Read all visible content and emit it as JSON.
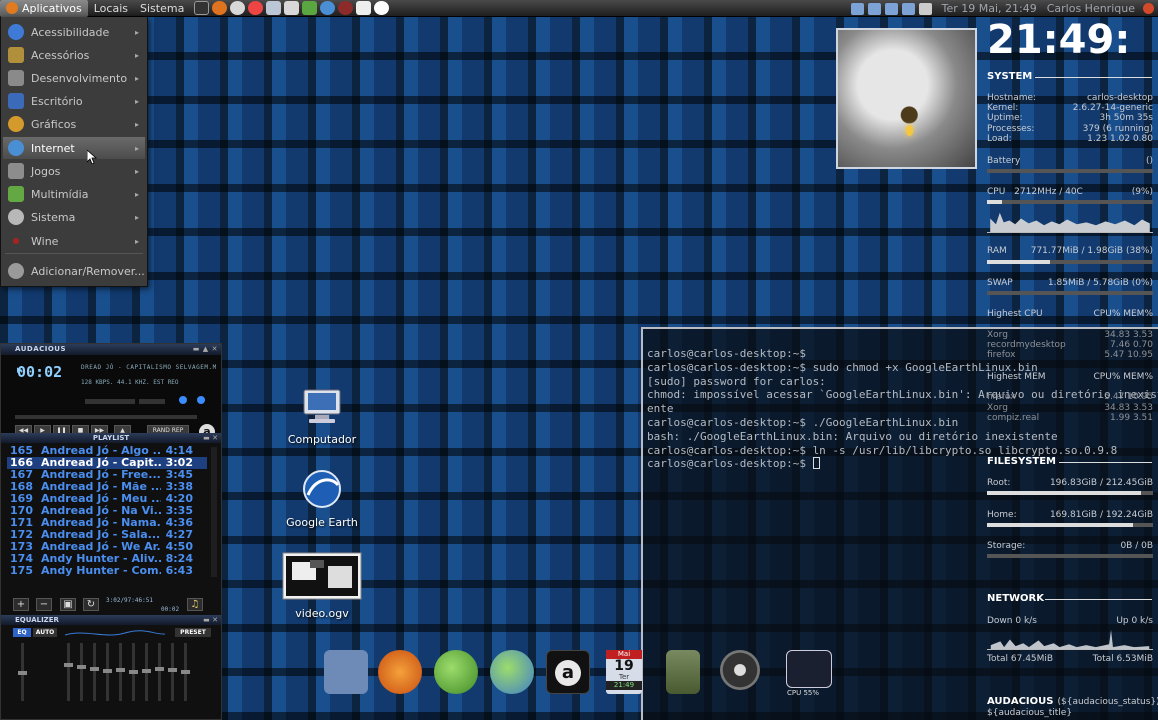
{
  "top_panel": {
    "menus": [
      "Aplicativos",
      "Locais",
      "Sistema"
    ],
    "launcher_icons": [
      "terminal-icon",
      "firefox-icon",
      "chat-icon",
      "help-icon",
      "mail-icon",
      "file-manager-icon",
      "users-icon",
      "network-icon",
      "media-icon",
      "notes-icon",
      "audacious-icon"
    ],
    "tray_icons": [
      "user-icon",
      "user-alt-icon",
      "network-icon",
      "mail-icon",
      "volume-icon"
    ],
    "clock": "Ter 19 Mai, 21:49",
    "user": "Carlos Henrique",
    "colors": {
      "panel": "#2a2a2a",
      "active_menu": "#7a7a7a"
    }
  },
  "app_menu": {
    "items": [
      {
        "label": "Acessibilidade",
        "icon": "accessibility-icon",
        "color": "#3f7bd6"
      },
      {
        "label": "Acessórios",
        "icon": "accessories-icon",
        "color": "#b0903a"
      },
      {
        "label": "Desenvolvimento",
        "icon": "development-icon",
        "color": "#8a8a8a"
      },
      {
        "label": "Escritório",
        "icon": "office-icon",
        "color": "#3a6ab8"
      },
      {
        "label": "Gráficos",
        "icon": "graphics-icon",
        "color": "#d59a2c"
      },
      {
        "label": "Internet",
        "icon": "internet-icon",
        "color": "#4a8fd4"
      },
      {
        "label": "Jogos",
        "icon": "games-icon",
        "color": "#8d8d8d"
      },
      {
        "label": "Multimídia",
        "icon": "multimedia-icon",
        "color": "#63a843"
      },
      {
        "label": "Sistema",
        "icon": "system-icon",
        "color": "#b8b8b8"
      },
      {
        "label": "Wine",
        "icon": "wine-icon",
        "color": "#a82222"
      }
    ],
    "extra": {
      "label": "Adicionar/Remover...",
      "icon": "add-remove-icon"
    }
  },
  "audacious": {
    "title": "AUDACIOUS",
    "time": "00:02",
    "track_marquee": "DREAD JÓ - CAPITALISMO SELVAGEM.M",
    "stream_info": "128 KBPS. 44.1 KHZ. EST REO",
    "shuffle_repeat": "RAND REP",
    "playlist_title": "PLAYLIST",
    "playlist": [
      {
        "num": "165",
        "title": "Andread Jó - Algo ...",
        "dur": "4:14"
      },
      {
        "num": "166",
        "title": "Andread Jó - Capit...",
        "dur": "3:02"
      },
      {
        "num": "167",
        "title": "Andread Jó - Free...",
        "dur": "3:45"
      },
      {
        "num": "168",
        "title": "Andread Jó - Mãe ...",
        "dur": "3:38"
      },
      {
        "num": "169",
        "title": "Andread Jó - Meu ...",
        "dur": "4:20"
      },
      {
        "num": "170",
        "title": "Andread Jó - Na Vi...",
        "dur": "3:35"
      },
      {
        "num": "171",
        "title": "Andread Jó - Nama...",
        "dur": "4:36"
      },
      {
        "num": "172",
        "title": "Andread Jó - Sala...",
        "dur": "4:27"
      },
      {
        "num": "173",
        "title": "Andread Jó - We Ar...",
        "dur": "4:50"
      },
      {
        "num": "174",
        "title": "Andy Hunter - Aliv...",
        "dur": "8:24"
      },
      {
        "num": "175",
        "title": "Andy Hunter - Com...",
        "dur": "6:43"
      }
    ],
    "selected_index": 1,
    "playlist_totals": "3:02/97:46:51",
    "mini_time": "00:02",
    "equalizer_title": "EQUALIZER",
    "eq_buttons": {
      "eq": "EQ",
      "auto": "AUTO",
      "preset": "PRESET"
    }
  },
  "desktop_icons": [
    {
      "label": "Computador",
      "icon": "computer-icon"
    },
    {
      "label": "Google Earth",
      "icon": "google-earth-icon"
    },
    {
      "label": "video.ogv",
      "icon": "video-file-icon"
    }
  ],
  "conky": {
    "clock": "21:49:",
    "system_header": "SYSTEM",
    "system": [
      {
        "label": "Hostname:",
        "value": "carlos-desktop"
      },
      {
        "label": "Kernel:",
        "value": "2.6.27-14-generic"
      },
      {
        "label": "Uptime:",
        "value": "3h 50m 35s"
      },
      {
        "label": "Processes:",
        "value": "379 (6 running)"
      },
      {
        "label": "Load:",
        "value": "1.23 1.02 0.80"
      }
    ],
    "battery": {
      "label": "Battery",
      "value": "()"
    },
    "cpu": {
      "label": "CPU",
      "freq": "2712MHz / 40C",
      "pct": "(9%)",
      "fraction": 0.09
    },
    "ram": {
      "label": "RAM",
      "value": "771.77MiB / 1.98GiB (38%)",
      "fraction": 0.38
    },
    "swap": {
      "label": "SWAP",
      "value": "1.85MiB / 5.78GiB (0%)",
      "fraction": 0.0
    },
    "highest_cpu": {
      "label": "Highest CPU",
      "cols": "CPU% MEM%",
      "rows": [
        {
          "name": "Xorg",
          "cpu": "34.83",
          "mem": "3.53"
        },
        {
          "name": "recordmydesktop",
          "cpu": "7.46",
          "mem": "0.70"
        },
        {
          "name": "firefox",
          "cpu": "5.47",
          "mem": "10.95"
        }
      ]
    },
    "highest_mem": {
      "label": "Highest MEM",
      "cols": "CPU% MEM%",
      "rows": [
        {
          "name": "firefox",
          "cpu": "5.47",
          "mem": "10.95"
        },
        {
          "name": "Xorg",
          "cpu": "34.83",
          "mem": "3.53"
        },
        {
          "name": "compiz.real",
          "cpu": "1.99",
          "mem": "3.51"
        }
      ]
    },
    "filesystem_header": "FILESYSTEM",
    "filesystem": [
      {
        "label": "Root:",
        "value": "196.83GiB / 212.45GiB",
        "fraction": 0.93
      },
      {
        "label": "Home:",
        "value": "169.81GiB / 192.24GiB",
        "fraction": 0.88
      },
      {
        "label": "Storage:",
        "value": "0B / 0B",
        "fraction": 0.0
      }
    ],
    "network_header": "NETWORK",
    "net": {
      "down": "Down 0 k/s",
      "up": "Up 0 k/s",
      "total_down": "Total 67.45MiB",
      "total_up": "Total 6.53MiB"
    },
    "audacious_header": "AUDACIOUS",
    "audacious_status": "(${audacious_status})",
    "audacious_title_tpl": "${audacious_title}"
  },
  "terminal": {
    "lines": [
      "carlos@carlos-desktop:~$",
      "carlos@carlos-desktop:~$ sudo chmod +x GoogleEarthLinux.bin",
      "[sudo] password for carlos:",
      "chmod: impossível acessar `GoogleEarthLinux.bin': Arquivo ou diretório inexist",
      "ente",
      "carlos@carlos-desktop:~$  ./GoogleEarthLinux.bin",
      "bash: ./GoogleEarthLinux.bin: Arquivo ou diretório inexistente",
      "carlos@carlos-desktop:~$  ln -s /usr/lib/libcrypto.so libcrypto.so.0.9.8",
      "carlos@carlos-desktop:~$ "
    ]
  },
  "dock": {
    "items": [
      {
        "icon": "file-manager-dock-icon",
        "color": "#6e8bb8"
      },
      {
        "icon": "firefox-dock-icon",
        "color": "#e0731f"
      },
      {
        "icon": "messenger-dock-icon",
        "color": "#5aa640"
      },
      {
        "icon": "messenger-alt-dock-icon",
        "color": "#4f8fd0"
      },
      {
        "icon": "audacious-dock-icon",
        "color": "#e8e8e8"
      },
      {
        "icon": "calendar-dock-icon",
        "color": "#c9d3e0",
        "month": "Mai",
        "day": "19",
        "weekday": "Ter",
        "time": "21:49"
      },
      {
        "icon": "speaker-dock-icon",
        "color": "#6a7a50"
      },
      {
        "icon": "volume-dock-icon",
        "color": "#9a9a9a"
      },
      {
        "icon": "cpu-monitor-dock-icon",
        "color": "#1a2030",
        "label": "CPU 55%"
      }
    ]
  }
}
